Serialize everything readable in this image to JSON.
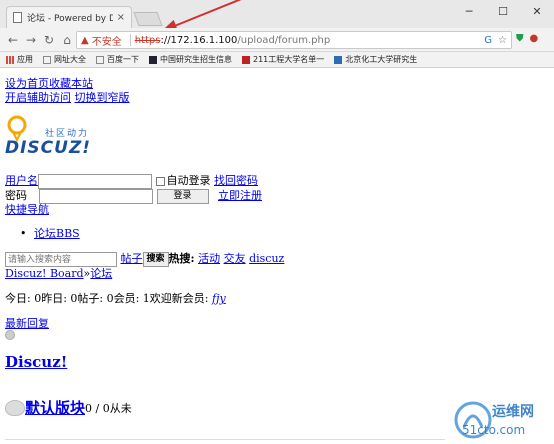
{
  "browser": {
    "tab_title": "论坛 - Powered by Discuz",
    "tab_close": "×",
    "win_min": "─",
    "win_max": "☐",
    "win_close": "✕",
    "not_secure": "不安全",
    "url_scheme": "https",
    "url_host": "://172.16.1.100",
    "url_path": "/upload/forum.php",
    "bookmarks": [
      {
        "label": "应用"
      },
      {
        "label": "网址大全"
      },
      {
        "label": "百度一下"
      },
      {
        "label": "中国研究生招生信息"
      },
      {
        "label": "211工程大学名单一"
      },
      {
        "label": "北京化工大学研究生"
      }
    ]
  },
  "page": {
    "set_home": "设为首页",
    "bookmark_site": "收藏本站",
    "accessibility": "开启辅助访问",
    "switch_width": "切换到窄版",
    "logo_tagline": "社区动力",
    "logo_text": "DISCUZ!",
    "username_label": "用户名",
    "password_label": "密码",
    "auto_login": "自动登录",
    "find_password": "找回密码",
    "login_btn": "登录",
    "register": "立即注册",
    "quick_nav": "快捷导航",
    "forum_bbs": "论坛BBS",
    "search_placeholder": "请输入搜索内容",
    "search_type": "帖子",
    "search_btn": "搜索",
    "hot_label": "热搜:",
    "hot_1": "活动",
    "hot_2": "交友",
    "hot_3": "discuz",
    "breadcrumb_home": "Discuz! Board",
    "breadcrumb_sep": "»",
    "breadcrumb_forum": "论坛",
    "stats": "今日: 0昨日: 0帖子: 0会员: 1欢迎新会员: ",
    "new_member": "fjy",
    "latest_reply": "最新回复",
    "category_title": "Discuz!",
    "board_name": "默认版块",
    "board_stats": "0 / 0从未"
  },
  "watermark": {
    "brand": "运维网",
    "site": "51cto.com"
  }
}
